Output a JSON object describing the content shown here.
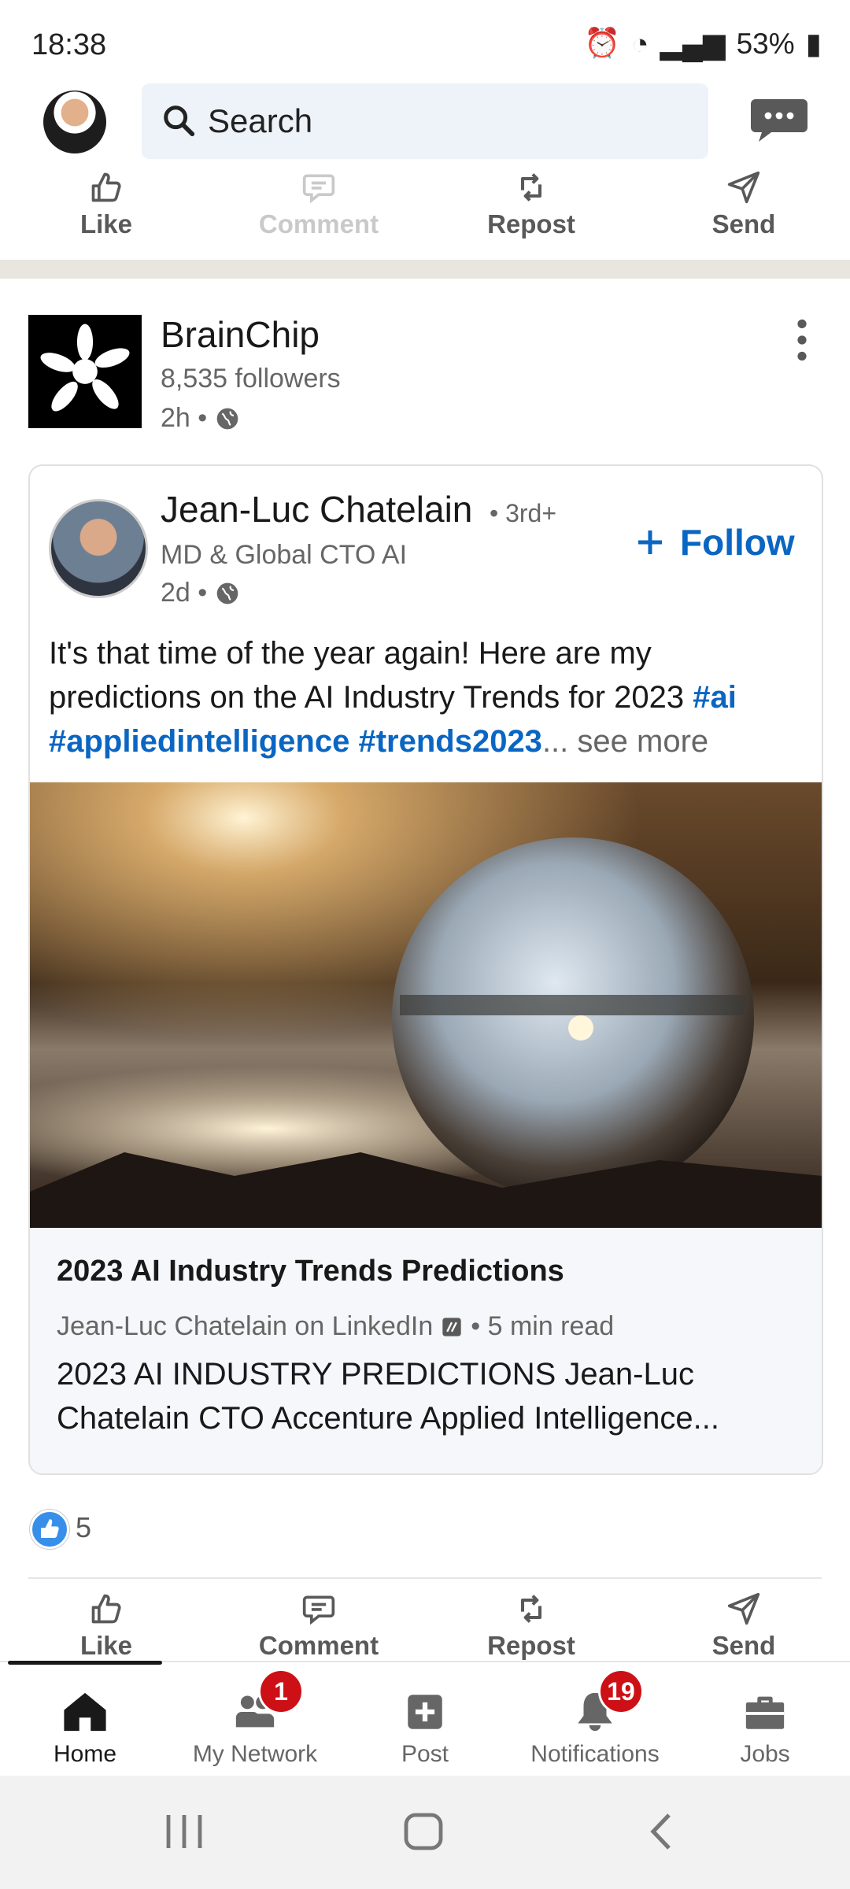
{
  "status_bar": {
    "time": "18:38",
    "battery": "53%"
  },
  "top_bar": {
    "search_label": "Search"
  },
  "actions_top": [
    {
      "label": "Like",
      "icon": "like-icon"
    },
    {
      "label": "Comment",
      "icon": "comment-icon"
    },
    {
      "label": "Repost",
      "icon": "repost-icon"
    },
    {
      "label": "Send",
      "icon": "send-icon"
    }
  ],
  "company": {
    "name": "BrainChip",
    "followers": "8,535 followers",
    "age": "2h •"
  },
  "post": {
    "author_name": "Jean-Luc Chatelain",
    "degree": "• 3rd+",
    "headline": "MD & Global CTO AI",
    "age": "2d •",
    "follow_label": "Follow",
    "text_main": "It's that time of the year again! Here are my predictions on the AI Industry Trends for 2023 ",
    "tag_ai": "#ai",
    "tag_applied": "#appliedintelligence",
    "tag_trends": "#trends2023",
    "see_more": "... see more"
  },
  "article": {
    "title": "2023 AI Industry Trends Predictions",
    "source": "Jean-Luc Chatelain on LinkedIn",
    "read_time": "• 5 min read",
    "snippet": "2023 AI INDUSTRY PREDICTIONS Jean-Luc Chatelain CTO Accenture Applied Intelligence..."
  },
  "reactions": {
    "count": "5"
  },
  "actions_bottom": [
    {
      "label": "Like"
    },
    {
      "label": "Comment"
    },
    {
      "label": "Repost"
    },
    {
      "label": "Send"
    }
  ],
  "bottom_nav": [
    {
      "label": "Home",
      "icon": "home-icon"
    },
    {
      "label": "My Network",
      "icon": "network-icon",
      "badge": "1"
    },
    {
      "label": "Post",
      "icon": "post-icon"
    },
    {
      "label": "Notifications",
      "icon": "bell-icon",
      "badge": "19"
    },
    {
      "label": "Jobs",
      "icon": "briefcase-icon"
    }
  ],
  "colors": {
    "linkedin_blue": "#0a66c2",
    "badge_red": "#cc1016"
  }
}
